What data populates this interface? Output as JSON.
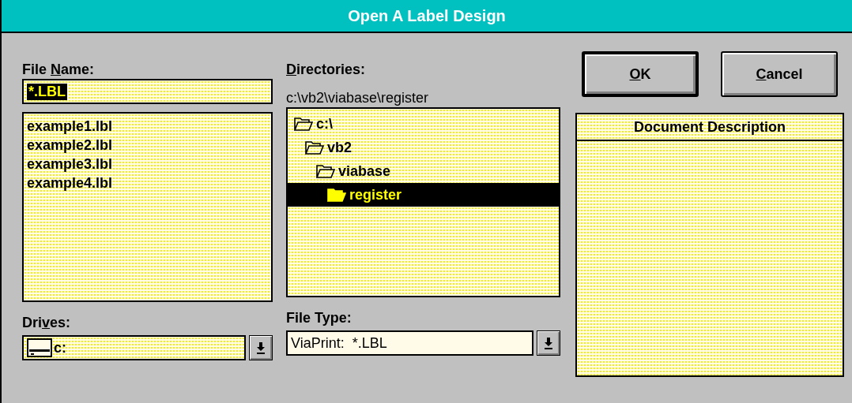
{
  "window": {
    "title": "Open A Label Design"
  },
  "file_name": {
    "label": [
      {
        "text": "File ",
        "underline": false
      },
      {
        "text": "N",
        "underline": true
      },
      {
        "text": "ame:",
        "underline": false
      }
    ],
    "value": "*.LBL",
    "highlighted": true
  },
  "files": [
    "example1.lbl",
    "example2.lbl",
    "example3.lbl",
    "example4.lbl"
  ],
  "directories": {
    "label": [
      {
        "text": "D",
        "underline": true
      },
      {
        "text": "irectories:",
        "underline": false
      }
    ],
    "path": "c:\\vb2\\viabase\\register",
    "tree": [
      {
        "name": "c:\\",
        "selected": false,
        "children": [
          {
            "name": "vb2",
            "selected": false,
            "children": [
              {
                "name": "viabase",
                "selected": false,
                "children": [
                  {
                    "name": "register",
                    "selected": true
                  }
                ]
              }
            ]
          }
        ]
      }
    ]
  },
  "drives": {
    "label": [
      {
        "text": "Dri",
        "underline": false
      },
      {
        "text": "v",
        "underline": true
      },
      {
        "text": "es:",
        "underline": false
      }
    ],
    "value": "c:"
  },
  "file_type": {
    "label": [
      {
        "text": "File Type:",
        "underline": false
      }
    ],
    "value": "ViaPrint:  *.LBL"
  },
  "buttons": [
    {
      "label": [
        {
          "text": "O",
          "underline": true
        },
        {
          "text": "K",
          "underline": false
        }
      ],
      "default": true
    },
    {
      "label": [
        {
          "text": "C",
          "underline": true
        },
        {
          "text": "ancel",
          "underline": false
        }
      ],
      "default": false
    }
  ],
  "description": {
    "header": "Document Description"
  }
}
